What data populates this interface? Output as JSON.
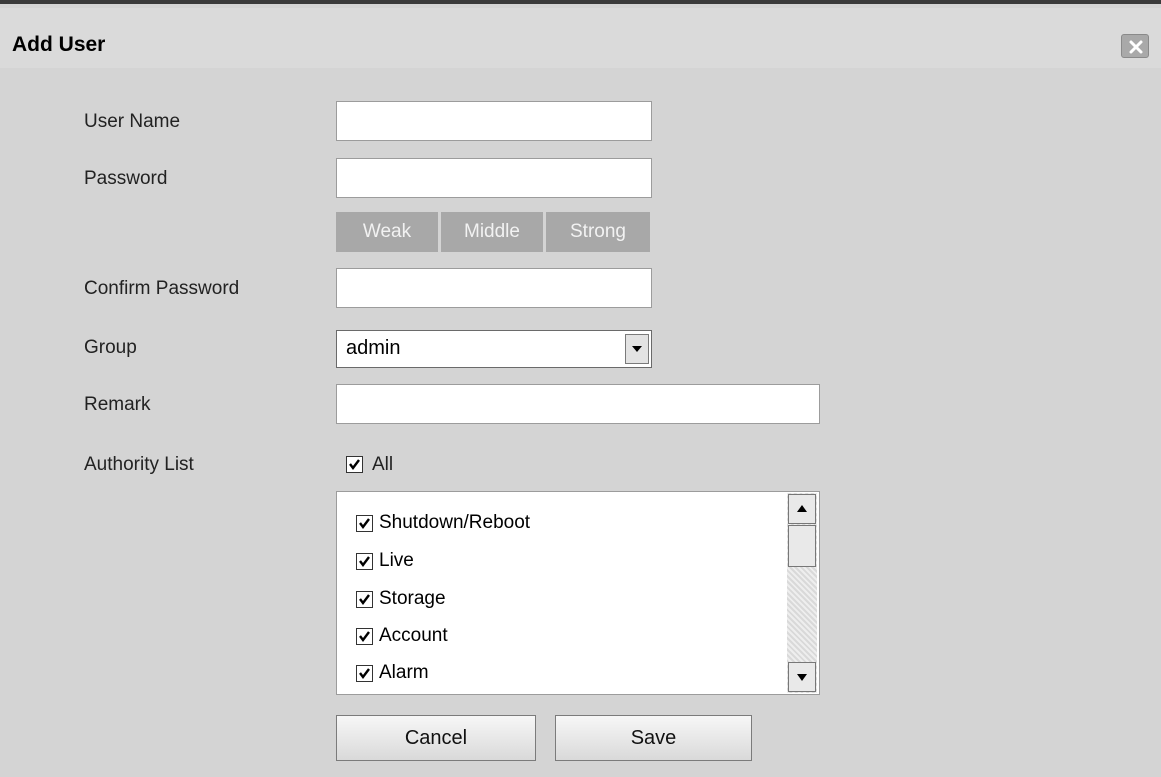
{
  "dialog": {
    "title": "Add User",
    "close_icon": "close-icon"
  },
  "form": {
    "user_name_label": "User Name",
    "user_name_value": "",
    "password_label": "Password",
    "password_value": "",
    "strength": [
      "Weak",
      "Middle",
      "Strong"
    ],
    "confirm_password_label": "Confirm Password",
    "confirm_password_value": "",
    "group_label": "Group",
    "group_value": "admin",
    "remark_label": "Remark",
    "remark_value": "",
    "authority_label": "Authority List",
    "all_label": "All",
    "all_checked": true
  },
  "authority_items": [
    {
      "label": "Shutdown/Reboot",
      "checked": true
    },
    {
      "label": "Live",
      "checked": true
    },
    {
      "label": "Storage",
      "checked": true
    },
    {
      "label": "Account",
      "checked": true
    },
    {
      "label": "Alarm",
      "checked": true
    }
  ],
  "buttons": {
    "cancel_label": "Cancel",
    "save_label": "Save"
  }
}
